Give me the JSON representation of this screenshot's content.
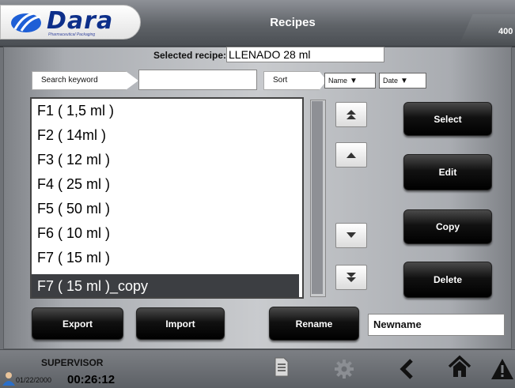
{
  "header": {
    "logo_text": "Dara",
    "logo_sub": "Pharmaceutical Packaging",
    "title": "Recipes",
    "corner_number": "400"
  },
  "selected_recipe": {
    "label": "Selected recipe:",
    "value": "LLENADO 28 ml"
  },
  "search": {
    "label": "Search keyword",
    "value": ""
  },
  "sort": {
    "label": "Sort",
    "options": [
      "Name",
      "Date"
    ]
  },
  "recipes": [
    "F1 ( 1,5 ml )",
    "F2 ( 14ml )",
    "F3 ( 12 ml )",
    "F4 ( 25 ml )",
    "F5 ( 50 ml )",
    "F6 ( 10 ml )",
    "F7 ( 15 ml )",
    "F7 ( 15 ml )_copy"
  ],
  "selected_index": 7,
  "actions": {
    "select": "Select",
    "edit": "Edit",
    "copy": "Copy",
    "delete": "Delete",
    "export": "Export",
    "import": "Import",
    "rename": "Rename"
  },
  "rename_value": "Newname",
  "footer": {
    "user": "SUPERVISOR",
    "date": "01/22/2000",
    "time": "00:26:12"
  },
  "icons": [
    "user-icon",
    "document-icon",
    "gear-icon",
    "back-chevron-icon",
    "home-icon",
    "warning-icon"
  ],
  "colors": {
    "brand_blue": "#0d2f8a",
    "selected_row": "#3c3e42"
  }
}
